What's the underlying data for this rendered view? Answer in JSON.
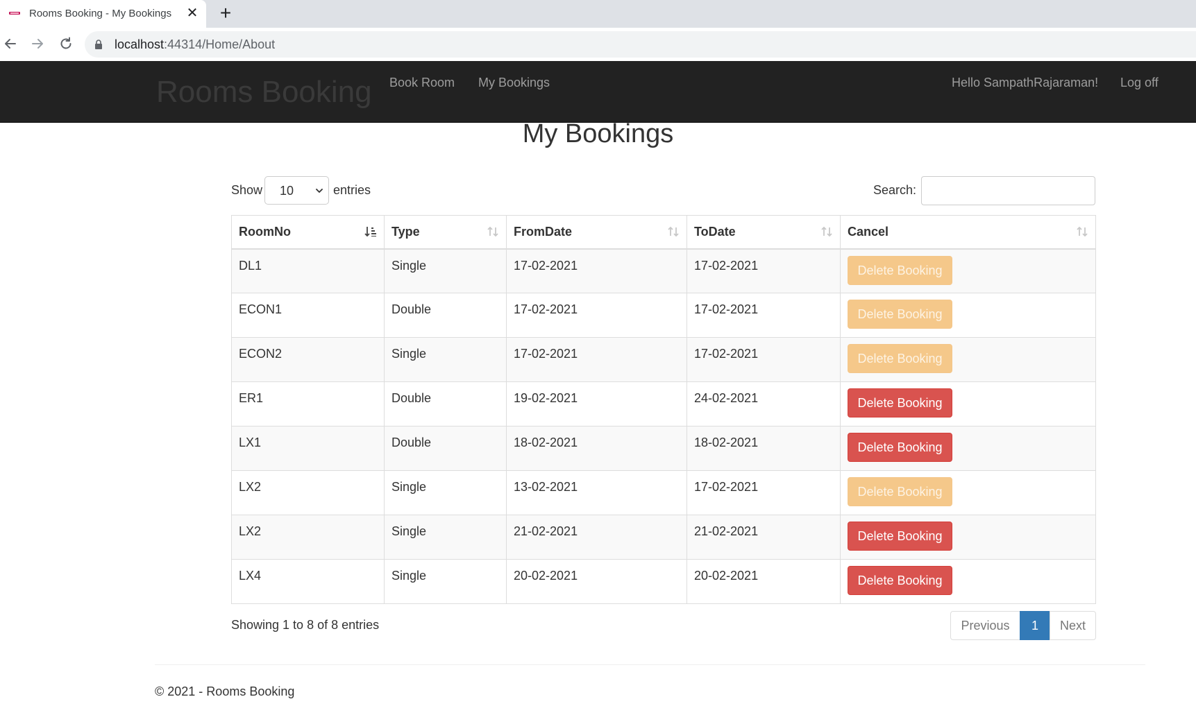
{
  "browser": {
    "tab_title": "Rooms Booking - My Bookings",
    "url_host": "localhost",
    "url_rest": ":44314/Home/About"
  },
  "navbar": {
    "brand": "Rooms Booking",
    "links": [
      "Book Room",
      "My Bookings"
    ],
    "greeting": "Hello SampathRajaraman!",
    "logoff": "Log off"
  },
  "page": {
    "title": "My Bookings",
    "show_label": "Show",
    "entries_label": "entries",
    "page_length": "10",
    "search_label": "Search:",
    "search_value": ""
  },
  "table": {
    "columns": [
      "RoomNo",
      "Type",
      "FromDate",
      "ToDate",
      "Cancel"
    ],
    "rows": [
      {
        "room": "DL1",
        "type": "Single",
        "from": "17-02-2021",
        "to": "17-02-2021",
        "cancel": "Delete Booking",
        "enabled": false
      },
      {
        "room": "ECON1",
        "type": "Double",
        "from": "17-02-2021",
        "to": "17-02-2021",
        "cancel": "Delete Booking",
        "enabled": false
      },
      {
        "room": "ECON2",
        "type": "Single",
        "from": "17-02-2021",
        "to": "17-02-2021",
        "cancel": "Delete Booking",
        "enabled": false
      },
      {
        "room": "ER1",
        "type": "Double",
        "from": "19-02-2021",
        "to": "24-02-2021",
        "cancel": "Delete Booking",
        "enabled": true
      },
      {
        "room": "LX1",
        "type": "Double",
        "from": "18-02-2021",
        "to": "18-02-2021",
        "cancel": "Delete Booking",
        "enabled": true
      },
      {
        "room": "LX2",
        "type": "Single",
        "from": "13-02-2021",
        "to": "17-02-2021",
        "cancel": "Delete Booking",
        "enabled": false
      },
      {
        "room": "LX2",
        "type": "Single",
        "from": "21-02-2021",
        "to": "21-02-2021",
        "cancel": "Delete Booking",
        "enabled": true
      },
      {
        "room": "LX4",
        "type": "Single",
        "from": "20-02-2021",
        "to": "20-02-2021",
        "cancel": "Delete Booking",
        "enabled": true
      }
    ]
  },
  "footer_info": "Showing 1 to 8 of 8 entries",
  "pagination": {
    "previous": "Previous",
    "current": "1",
    "next": "Next"
  },
  "footer": "© 2021 - Rooms Booking",
  "colors": {
    "navbar_bg": "#222222",
    "danger": "#d9534f",
    "danger_disabled": "#f5c88a",
    "primary": "#337ab7"
  },
  "icons": {
    "sort_asc": "sort-ascending-icon",
    "sort_both": "sort-both-icon"
  }
}
